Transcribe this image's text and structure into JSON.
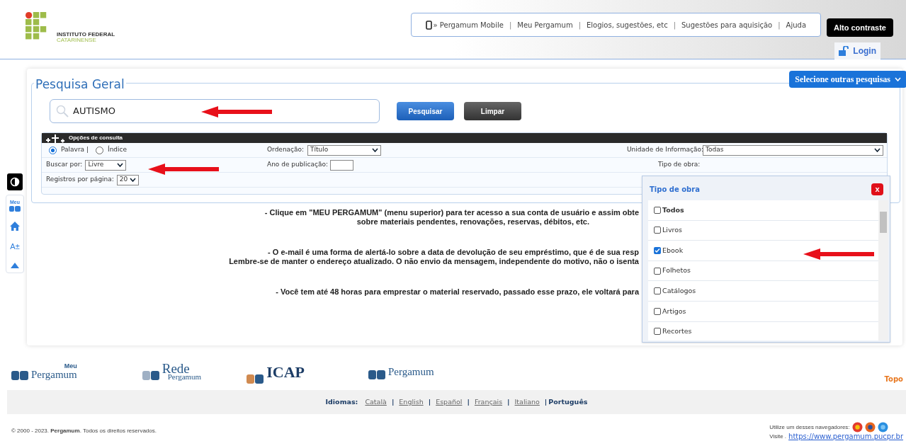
{
  "header": {
    "logo_lines": [
      "INSTITUTO FEDERAL",
      "CATARINENSE"
    ],
    "top_links": [
      "» Pergamum Mobile",
      "Meu Pergamum",
      "Elogios, sugestões, etc",
      "Sugestões para aquisição",
      "Ajuda"
    ],
    "link_separator": "|",
    "contrast_button": "Alto contraste",
    "login": "Login"
  },
  "search": {
    "title": "Pesquisa Geral",
    "other_searches": "Selecione outras pesquisas",
    "query": "AUTISMO",
    "buttons": [
      "Pesquisar",
      "Limpar"
    ]
  },
  "options": {
    "title": "Opções de consulta",
    "modes": [
      {
        "label": "Palavra |",
        "selected": true
      },
      {
        "label": "Índice",
        "selected": false
      }
    ],
    "order": {
      "label": "Ordenação:",
      "value": "Título"
    },
    "unit": {
      "label": "Unidade de Informação:",
      "value": "Todas"
    },
    "search_by": {
      "label": "Buscar por:",
      "value": "Livre"
    },
    "year": {
      "label": "Ano de publicação:"
    },
    "work_type": {
      "label": "Tipo de obra:"
    },
    "per_page": {
      "label": "Registros por página:",
      "value": "20"
    }
  },
  "work_type_popup": {
    "title": "Tipo de obra",
    "close": "x",
    "items": [
      {
        "label": "Todos",
        "checked": false,
        "bold": true
      },
      {
        "label": "Livros",
        "checked": false,
        "bold": false
      },
      {
        "label": "Ebook",
        "checked": true,
        "bold": false
      },
      {
        "label": "Folhetos",
        "checked": false,
        "bold": false
      },
      {
        "label": "Catálogos",
        "checked": false,
        "bold": false
      },
      {
        "label": "Artigos",
        "checked": false,
        "bold": false
      },
      {
        "label": "Recortes",
        "checked": false,
        "bold": false
      }
    ]
  },
  "side_toolbar": {
    "font_size": "A±",
    "menu_label": "Meu"
  },
  "messages": [
    [
      "- Clique em \"MEU PERGAMUM\" (menu superior) para ter acesso a sua conta de usuário e assim obte",
      "sobre materiais pendentes, renovações, reservas, débitos, etc."
    ],
    [
      "- O e-mail é uma forma de alertá-lo sobre a data de devolução de seu empréstimo, que é de sua resp",
      "Lembre-se de manter o endereço atualizado. O não envio da mensagem, independente do motivo, não o isenta"
    ],
    [
      "- Você tem até 48 horas para emprestar o material reservado, passado esse prazo, ele voltará para"
    ]
  ],
  "footer": {
    "logos": [
      {
        "kind": "meu",
        "text": "Pergamum",
        "top": "Meu"
      },
      {
        "kind": "rede",
        "text": "Rede",
        "top": "Pergamum"
      },
      {
        "kind": "icap",
        "text": "ICAP"
      },
      {
        "kind": "pergamum",
        "text": "Pergamum"
      }
    ],
    "top_link": "Topo",
    "languages_label": "Idiomas:",
    "language_separator": "|",
    "languages": [
      {
        "label": "Català",
        "selected": false
      },
      {
        "label": "English",
        "selected": false
      },
      {
        "label": "Español",
        "selected": false
      },
      {
        "label": "Français",
        "selected": false
      },
      {
        "label": "Italiano",
        "selected": false
      },
      {
        "label": "Português",
        "selected": true
      }
    ],
    "copyright": "© 2000 - 2023. **Pergamum**. Todos os direitos reservados.",
    "browsers": "Utilize um desses navegadores:",
    "visit": "Visite .",
    "visit_link": "https://www.pergamum.pucpr.br"
  }
}
